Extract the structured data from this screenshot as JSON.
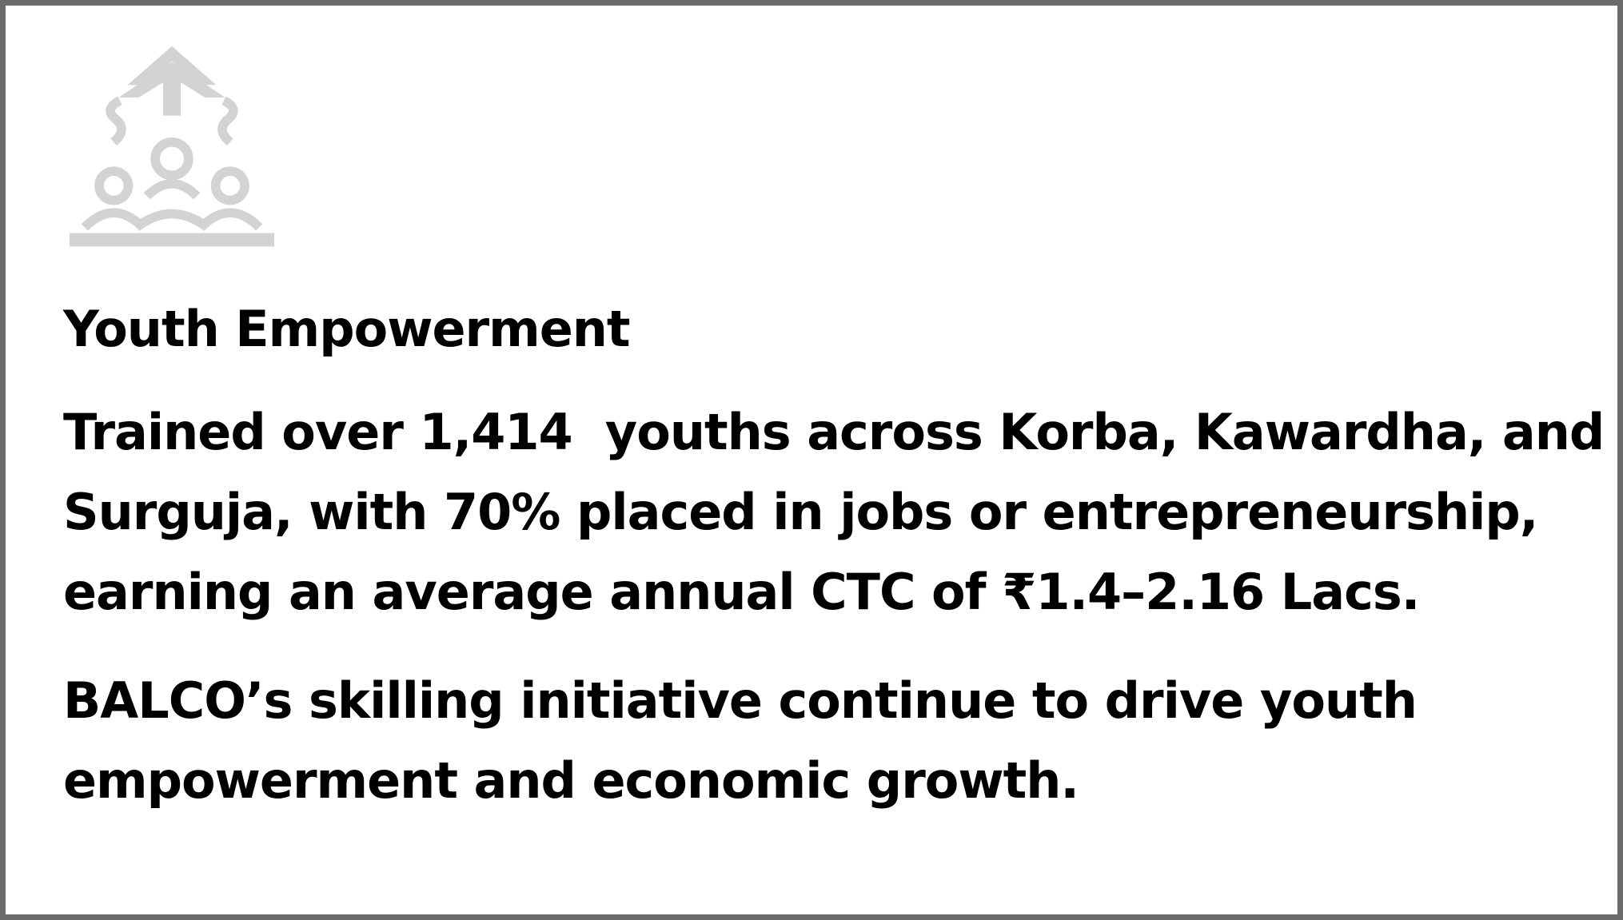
{
  "card": {
    "logo_icon": "community-people-icon",
    "title": "Youth Empowerment",
    "paragraphs": [
      "Trained over 1,414  youths across Korba, Kawardha, and Surguja, with 70% placed in jobs or entrepreneurship, earning an average annual CTC of ₹1.4–2.16 Lacs.",
      "BALCO’s skilling initiative continue to drive youth empowerment and economic growth."
    ]
  },
  "colors": {
    "border": "#6a6a6a",
    "logo": "#d3d3d3",
    "text": "#000000",
    "background": "#ffffff"
  }
}
